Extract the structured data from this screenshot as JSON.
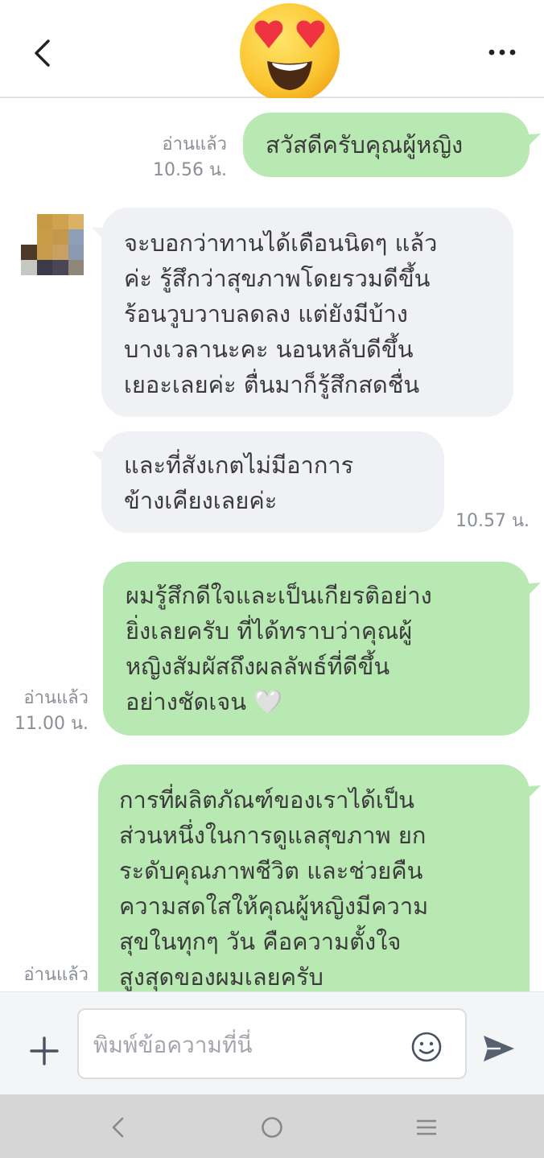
{
  "header": {
    "back_icon": "chevron-left-icon",
    "title_emoji": "heart-eyes-emoji",
    "more_icon": "more-dots-icon"
  },
  "messages": [
    {
      "dir": "out",
      "text": [
        "สวัสดีครับคุณผู้หญิง"
      ],
      "read": "อ่านแล้ว",
      "time": "10.56 น."
    },
    {
      "dir": "in",
      "text": [
        "จะบอกว่าทานได้เดือนนิดๆ แล้ว",
        "ค่ะ รู้สึกว่าสุขภาพโดยรวมดีขึ้น",
        "ร้อนวูบวาบลดลง แต่ยังมีบ้าง",
        "บางเวลานะคะ นอนหลับดีขึ้น",
        "เยอะเลยค่ะ ตื่นมาก็รู้สึกสดชื่น"
      ]
    },
    {
      "dir": "in",
      "text": [
        "และที่สังเกตไม่มีอาการ",
        "ข้างเคียงเลยค่ะ"
      ],
      "time": "10.57 น."
    },
    {
      "dir": "out",
      "text": [
        "ผมรู้สึกดีใจและเป็นเกียรติอย่าง",
        "ยิ่งเลยครับ ที่ได้ทราบว่าคุณผู้",
        "หญิงสัมผัสถึงผลลัพธ์ที่ดีขึ้น",
        "อย่างชัดเจน 🤍"
      ],
      "read": "อ่านแล้ว",
      "time": "11.00 น."
    },
    {
      "dir": "out",
      "text": [
        "การที่ผลิตภัณฑ์ของเราได้เป็น",
        "ส่วนหนึ่งในการดูแลสุขภาพ ยก",
        "ระดับคุณภาพชีวิต และช่วยคืน",
        "ความสดใสให้คุณผู้หญิงมีความ",
        "สุขในทุกๆ วัน คือความตั้งใจ",
        "สูงสุดของผมเลยครับ"
      ],
      "read": "อ่านแล้ว"
    }
  ],
  "input": {
    "placeholder": "พิมพ์ข้อความที่นี่",
    "plus_icon": "plus-icon",
    "emoji_icon": "smiley-icon",
    "send_icon": "send-icon"
  },
  "navbar": {
    "back_icon": "nav-back-icon",
    "home_icon": "nav-home-icon",
    "menu_icon": "nav-menu-icon"
  },
  "colors": {
    "outgoing_bubble": "#b9e9b2",
    "incoming_bubble": "#f0f1f4",
    "meta_text": "#8a8f96"
  }
}
